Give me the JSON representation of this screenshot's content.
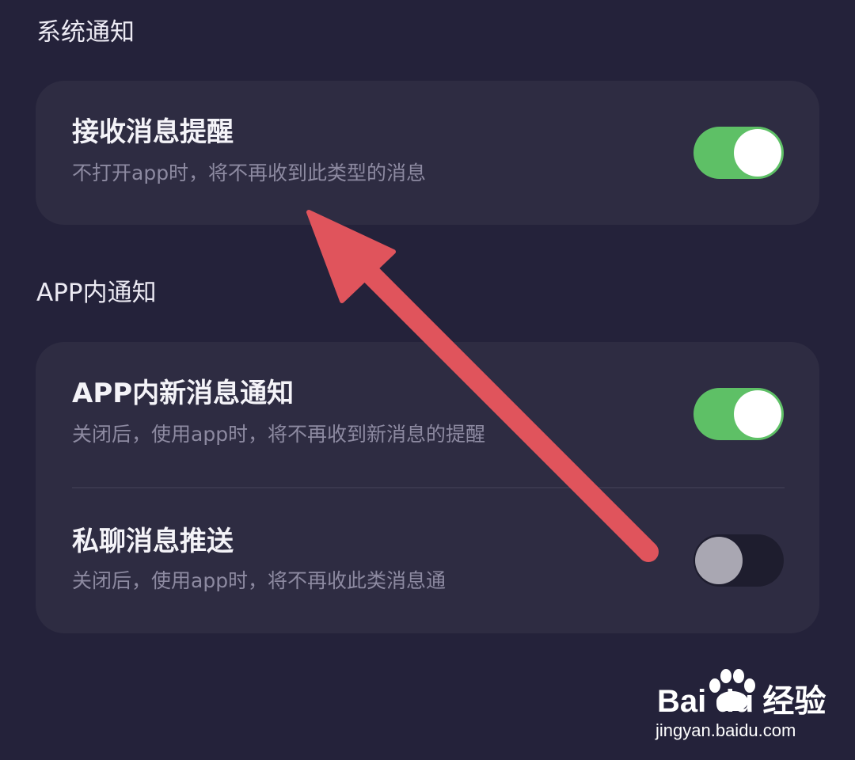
{
  "sections": [
    {
      "title": "系统通知",
      "items": [
        {
          "title": "接收消息提醒",
          "subtitle": "不打开app时，将不再收到此类型的消息",
          "enabled": true
        }
      ]
    },
    {
      "title": "APP内通知",
      "items": [
        {
          "title": "APP内新消息通知",
          "subtitle": "关闭后，使用app时，将不再收到新消息的提醒",
          "enabled": true
        },
        {
          "title": "私聊消息推送",
          "subtitle": "关闭后，使用app时，将不再收此类消息通",
          "enabled": false
        }
      ]
    }
  ],
  "colors": {
    "background": "#24223a",
    "card": "#2e2c42",
    "toggle_on": "#5ec066",
    "toggle_off": "#1e1d2e",
    "arrow": "#e0545c"
  },
  "annotation": {
    "icon": "arrow-up-left-icon"
  },
  "watermark": {
    "brand": "Bai du 经验",
    "url": "jingyan.baidu.com",
    "icon": "paw-icon"
  }
}
